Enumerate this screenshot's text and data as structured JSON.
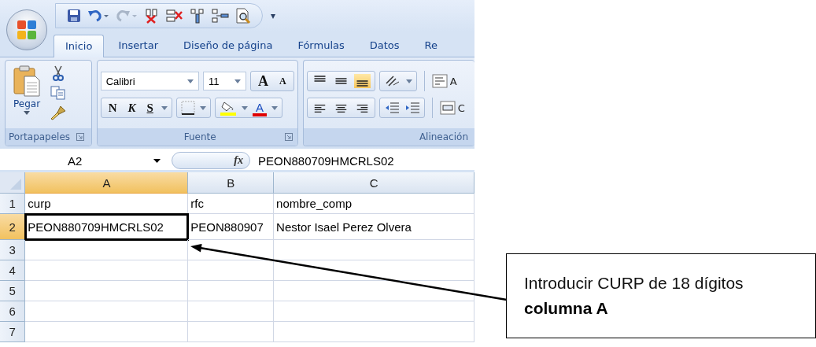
{
  "quick_access": {
    "customize": "▾"
  },
  "tabs": [
    {
      "label": "Inicio",
      "selected": true
    },
    {
      "label": "Insertar",
      "selected": false
    },
    {
      "label": "Diseño de página",
      "selected": false
    },
    {
      "label": "Fórmulas",
      "selected": false
    },
    {
      "label": "Datos",
      "selected": false
    },
    {
      "label": "Re",
      "selected": false
    }
  ],
  "ribbon": {
    "clipboard": {
      "label": "Portapapeles",
      "paste": "Pegar"
    },
    "font": {
      "label": "Fuente",
      "name": "Calibri",
      "size": "11",
      "grow": "A",
      "shrink": "A",
      "bold": "N",
      "italic": "K",
      "underline": "S",
      "font_color": "A"
    },
    "alignment": {
      "label": "Alineación",
      "vertical": [
        {
          "kind": "top",
          "selected": false
        },
        {
          "kind": "middle",
          "selected": false
        },
        {
          "kind": "bottom",
          "selected": true
        }
      ],
      "wrap": "A",
      "merge": "C"
    }
  },
  "formula_bar": {
    "name_box": "A2",
    "fx": "fx",
    "value": "PEON880709HMCRLS02"
  },
  "columns": [
    {
      "label": "A",
      "selected": true
    },
    {
      "label": "B",
      "selected": false
    },
    {
      "label": "C",
      "selected": false
    }
  ],
  "rows": [
    {
      "label": "1",
      "selected": false,
      "cells": [
        "curp",
        "rfc",
        "nombre_comp"
      ]
    },
    {
      "label": "2",
      "selected": true,
      "cells": [
        "PEON880709HMCRLS02",
        "PEON880907",
        "Nestor Isael Perez Olvera"
      ]
    },
    {
      "label": "3",
      "selected": false,
      "cells": []
    },
    {
      "label": "4",
      "selected": false,
      "cells": []
    },
    {
      "label": "5",
      "selected": false,
      "cells": []
    },
    {
      "label": "6",
      "selected": false,
      "cells": []
    },
    {
      "label": "7",
      "selected": false,
      "cells": []
    }
  ],
  "callout": {
    "text": "Introducir CURP de 18 dígitos",
    "emphasis": "columna A"
  }
}
